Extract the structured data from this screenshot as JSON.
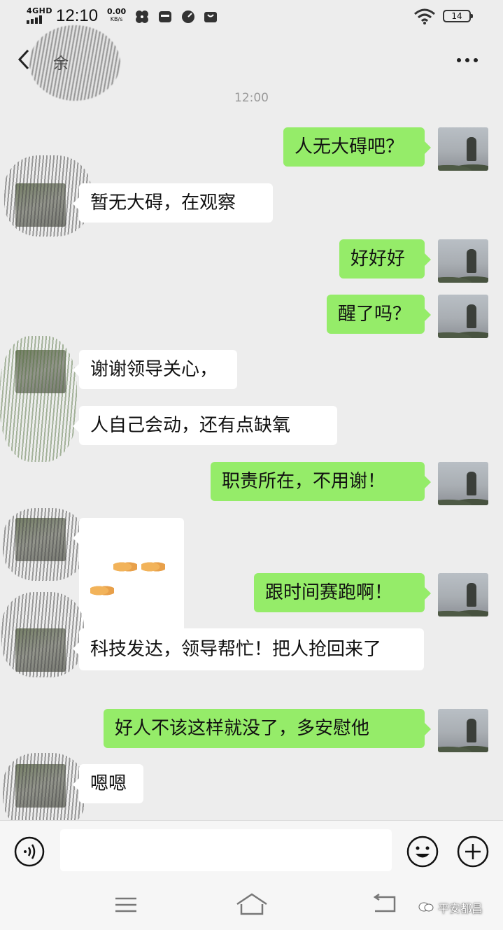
{
  "status_bar": {
    "network": "4GHD",
    "time": "12:10",
    "speed_value": "0.00",
    "speed_unit": "KB/s",
    "battery": "14"
  },
  "header": {
    "title": "余",
    "more_label": "..."
  },
  "chat": {
    "timestamp": "12:00",
    "messages": [
      {
        "from": "me",
        "text": "人无大碍吧？"
      },
      {
        "from": "them",
        "text": "暂无大碍，在观察"
      },
      {
        "from": "me",
        "text": "好好好"
      },
      {
        "from": "me",
        "text": "醒了吗？"
      },
      {
        "from": "them",
        "text": "谢谢领导关心，"
      },
      {
        "from": "them",
        "text": "人自己会动，还有点缺氧"
      },
      {
        "from": "me",
        "text": "职责所在，不用谢！"
      },
      {
        "from": "them",
        "text": "🤝🤝🤝",
        "emoji": "handshake x3"
      },
      {
        "from": "me",
        "text": "跟时间赛跑啊！"
      },
      {
        "from": "them",
        "text": "科技发达，领导帮忙！把人抢回来了"
      },
      {
        "from": "me",
        "text": "好人不该这样就没了，多安慰他"
      },
      {
        "from": "them",
        "text": "嗯嗯"
      }
    ]
  },
  "input_bar": {
    "input_value": "",
    "icons": [
      "voice-icon",
      "emoji-icon",
      "plus-icon"
    ]
  },
  "nav_bar": {
    "icons": [
      "menu-icon",
      "home-icon",
      "back-icon"
    ]
  },
  "watermark": {
    "label": "平安都昌"
  },
  "colors": {
    "background": "#ededed",
    "my_bubble": "#95ec69",
    "their_bubble": "#ffffff"
  }
}
